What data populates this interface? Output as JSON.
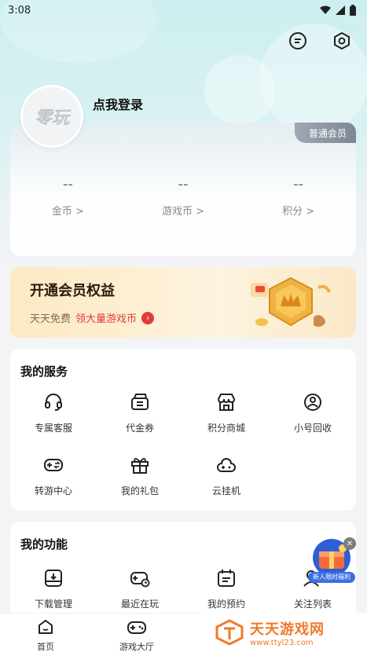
{
  "status": {
    "time": "3:08"
  },
  "user": {
    "avatar_text": "零玩",
    "login_label": "点我登录",
    "member_badge": "普通会员"
  },
  "assets": [
    {
      "value": "--",
      "label": "金币 >"
    },
    {
      "value": "--",
      "label": "游戏币 >"
    },
    {
      "value": "--",
      "label": "积分 >"
    }
  ],
  "vip": {
    "title": "开通会员权益",
    "sub_plain": "天天免费",
    "sub_highlight": "领大量游戏币"
  },
  "services": {
    "title": "我的服务",
    "items": [
      {
        "label": "专属客服",
        "icon": "headset-icon"
      },
      {
        "label": "代金券",
        "icon": "voucher-icon"
      },
      {
        "label": "积分商城",
        "icon": "store-icon"
      },
      {
        "label": "小号回收",
        "icon": "recycle-account-icon"
      },
      {
        "label": "转游中心",
        "icon": "gamepad-transfer-icon"
      },
      {
        "label": "我的礼包",
        "icon": "gift-icon"
      },
      {
        "label": "云挂机",
        "icon": "cloud-game-icon"
      }
    ]
  },
  "features": {
    "title": "我的功能",
    "items": [
      {
        "label": "下载管理",
        "icon": "download-icon"
      },
      {
        "label": "最近在玩",
        "icon": "recent-play-icon"
      },
      {
        "label": "我的预约",
        "icon": "calendar-icon"
      },
      {
        "label": "关注列表",
        "icon": "follow-icon"
      }
    ]
  },
  "promo": {
    "label": "新人限时福利"
  },
  "nav": [
    {
      "label": "首页",
      "icon": "home-icon"
    },
    {
      "label": "游戏大厅",
      "icon": "game-hall-icon"
    }
  ],
  "watermark": {
    "title": "天天游戏网",
    "url": "www.ttyl23.com"
  },
  "colors": {
    "accent_red": "#e23b3b",
    "badge_gray": "#8a939d",
    "watermark_orange": "#f07a2a"
  }
}
